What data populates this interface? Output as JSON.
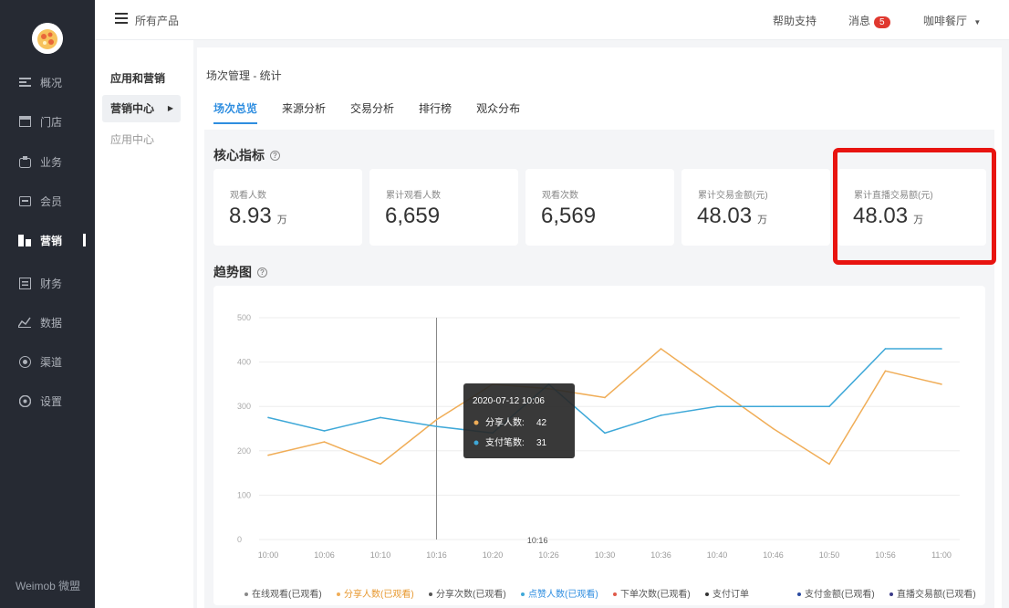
{
  "sidebar": {
    "items": [
      {
        "label": "概况",
        "icon": "overview-icon"
      },
      {
        "label": "门店",
        "icon": "store-icon"
      },
      {
        "label": "业务",
        "icon": "business-icon"
      },
      {
        "label": "会员",
        "icon": "member-icon"
      },
      {
        "label": "营销",
        "icon": "marketing-icon",
        "active": true
      },
      {
        "label": "财务",
        "icon": "finance-icon"
      },
      {
        "label": "数据",
        "icon": "data-icon"
      },
      {
        "label": "渠道",
        "icon": "channel-icon"
      },
      {
        "label": "设置",
        "icon": "settings-icon"
      }
    ],
    "brand": "Weimob 微盟"
  },
  "topbar": {
    "title": "所有产品",
    "help": "帮助支持",
    "messages": "消息",
    "message_count": "5",
    "shop": "咖啡餐厅"
  },
  "subnav": {
    "heading": "应用和营销",
    "items": [
      {
        "label": "营销中心",
        "active": true
      },
      {
        "label": "应用中心",
        "active": false
      }
    ]
  },
  "main": {
    "breadcrumb": "场次管理 - 统计",
    "tabs": [
      {
        "label": "场次总览",
        "active": true
      },
      {
        "label": "来源分析"
      },
      {
        "label": "交易分析"
      },
      {
        "label": "排行榜"
      },
      {
        "label": "观众分布"
      }
    ],
    "metrics_title": "核心指标",
    "metrics": [
      {
        "label": "观看人数",
        "value": "8.93",
        "unit": "万"
      },
      {
        "label": "累计观看人数",
        "value": "6,659",
        "unit": ""
      },
      {
        "label": "观看次数",
        "value": "6,569",
        "unit": ""
      },
      {
        "label": "累计交易金额(元)",
        "value": "48.03",
        "unit": "万"
      },
      {
        "label": "累计直播交易额(元)",
        "value": "48.03",
        "unit": "万"
      }
    ],
    "trend_title": "趋势图"
  },
  "colors": {
    "orange": "#f0ad57",
    "blue": "#3ea8d8",
    "highlight": "#e81410",
    "active_tab": "#2f8ee0"
  },
  "chart_data": {
    "type": "line",
    "x": [
      "10:00",
      "10:06",
      "10:10",
      "10:16",
      "10:20",
      "10:26",
      "10:30",
      "10:36",
      "10:40",
      "10:46",
      "10:50",
      "10:56",
      "11:00"
    ],
    "ylim": [
      0,
      500
    ],
    "yticks": [
      0,
      100,
      200,
      300,
      400,
      500
    ],
    "grid": true,
    "series": [
      {
        "name": "分享人数",
        "color": "#f0ad57",
        "values": [
          190,
          220,
          170,
          270,
          350,
          340,
          320,
          430,
          340,
          250,
          170,
          380,
          350
        ]
      },
      {
        "name": "支付笔数",
        "color": "#3ea8d8",
        "values": [
          275,
          245,
          275,
          255,
          240,
          350,
          240,
          280,
          300,
          300,
          300,
          430,
          430
        ]
      }
    ],
    "tooltip": {
      "title": "2020-07-12 10:06",
      "rows": [
        {
          "name": "分享人数",
          "value": "42"
        },
        {
          "name": "支付笔数",
          "value": "31"
        }
      ],
      "at_index": 4
    },
    "cursor_index": 3,
    "cursor_label": "10:16",
    "legend_position": "bottom",
    "legend": [
      {
        "name": "在线观看(已观看)",
        "color": "#888888"
      },
      {
        "name": "分享人数(已观看)",
        "color": "#f0ad57"
      },
      {
        "name": "分享次数(已观看)",
        "color": "#555555"
      },
      {
        "name": "点赞人数(已观看)",
        "color": "#3ea8d8"
      },
      {
        "name": "下单次数(已观看)",
        "color": "#e05a4a"
      },
      {
        "name": "支付订单",
        "color": "#333333"
      },
      {
        "name": "支付金额(已观看)",
        "color": "#2a4aa0"
      },
      {
        "name": "直播交易额(已观看)",
        "color": "#3a3a88"
      }
    ]
  }
}
